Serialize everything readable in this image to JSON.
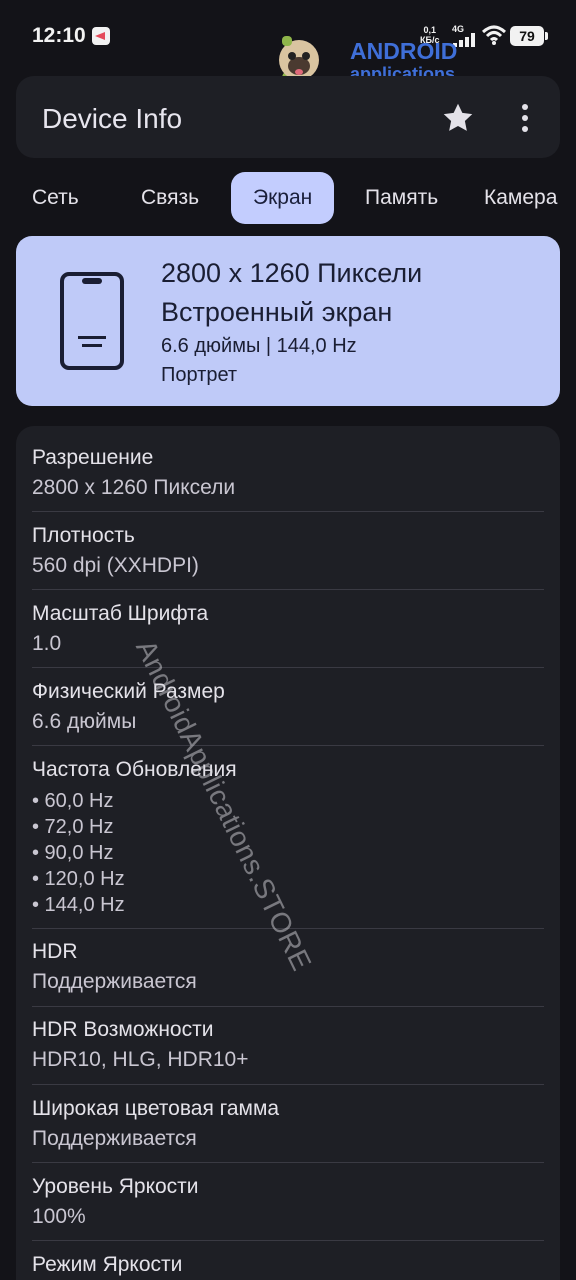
{
  "status_bar": {
    "time": "12:10",
    "net_speed_value": "0,1",
    "net_speed_unit": "КБ/с",
    "network_type": "4G",
    "battery": "79"
  },
  "watermark": {
    "brand": "ANDROID",
    "brand_sub": "applications",
    "diagonal_text": "AndroidApplications.STORE"
  },
  "app_bar": {
    "title": "Device Info"
  },
  "tabs": [
    {
      "label": "Сеть"
    },
    {
      "label": "Связь"
    },
    {
      "label": "Экран",
      "active": true
    },
    {
      "label": "Память"
    },
    {
      "label": "Камера"
    }
  ],
  "summary": {
    "resolution": "2800 x 1260 Пиксели",
    "display_type": "Встроенный экран",
    "size_rate": "6.6 дюймы | 144,0 Hz",
    "orientation": "Портрет"
  },
  "details": [
    {
      "label": "Разрешение",
      "value": "2800 x 1260 Пиксели"
    },
    {
      "label": "Плотность",
      "value": "560 dpi (XXHDPI)"
    },
    {
      "label": "Масштаб Шрифта",
      "value": "1.0"
    },
    {
      "label": "Физический Размер",
      "value": "6.6 дюймы"
    },
    {
      "label": "Частота Обновления",
      "values": [
        "• 60,0 Hz",
        "• 72,0 Hz",
        "• 90,0 Hz",
        "• 120,0 Hz",
        "• 144,0 Hz"
      ]
    },
    {
      "label": "HDR",
      "value": "Поддерживается"
    },
    {
      "label": "HDR Возможности",
      "value": "HDR10, HLG, HDR10+"
    },
    {
      "label": "Широкая цветовая гамма",
      "value": "Поддерживается"
    },
    {
      "label": "Уровень Яркости",
      "value": "100%"
    },
    {
      "label": "Режим Яркости",
      "value": ""
    }
  ],
  "colors": {
    "background": "#131318",
    "surface": "#1e1f25",
    "accent": "#c3cdfe",
    "summary_card": "#bfcaf8"
  }
}
